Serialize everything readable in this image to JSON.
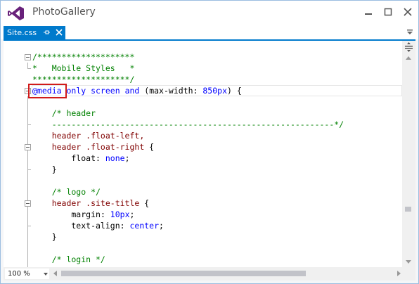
{
  "window": {
    "title": "PhotoGallery",
    "logo_icon": "visual-studio-logo",
    "controls": [
      "minimize-icon",
      "maximize-icon",
      "close-icon"
    ]
  },
  "tabs": [
    {
      "label": "Site.css",
      "active": true,
      "pinned_icon": "pin-icon",
      "close_icon": "close-icon"
    }
  ],
  "colors": {
    "accent": "#007acc",
    "comment": "#008000",
    "keyword": "#0000ff",
    "selector": "#800000",
    "property": "#ff0000",
    "value": "#0000ff",
    "highlight_box": "#d11a1a"
  },
  "editor": {
    "lines": [
      {
        "segments": [
          {
            "t": "/********************",
            "c": "comment"
          }
        ]
      },
      {
        "segments": [
          {
            "t": "*   Mobile Styles   *",
            "c": "comment"
          }
        ]
      },
      {
        "segments": [
          {
            "t": "********************/",
            "c": "comment"
          }
        ]
      },
      {
        "segments": [
          {
            "t": "@media",
            "c": "keyword"
          },
          {
            "t": " only screen ",
            "c": "keyword"
          },
          {
            "t": "and",
            "c": "keyword"
          },
          {
            "t": " (",
            "c": "plain"
          },
          {
            "t": "max-width",
            "c": "property"
          },
          {
            "t": ": ",
            "c": "plain"
          },
          {
            "t": "850px",
            "c": "value"
          },
          {
            "t": ") {",
            "c": "plain"
          }
        ]
      },
      {
        "segments": []
      },
      {
        "segments": [
          {
            "t": "    /* header",
            "c": "comment"
          }
        ]
      },
      {
        "segments": [
          {
            "t": "    ----------------------------------------------------------*/",
            "c": "comment"
          }
        ]
      },
      {
        "segments": [
          {
            "t": "    header .float-left,",
            "c": "selector"
          }
        ]
      },
      {
        "segments": [
          {
            "t": "    header .float-right",
            "c": "selector"
          },
          {
            "t": " {",
            "c": "plain"
          }
        ]
      },
      {
        "segments": [
          {
            "t": "        float",
            "c": "property"
          },
          {
            "t": ": ",
            "c": "plain"
          },
          {
            "t": "none",
            "c": "value"
          },
          {
            "t": ";",
            "c": "plain"
          }
        ]
      },
      {
        "segments": [
          {
            "t": "    }",
            "c": "plain"
          }
        ]
      },
      {
        "segments": []
      },
      {
        "segments": [
          {
            "t": "    /* logo */",
            "c": "comment"
          }
        ]
      },
      {
        "segments": [
          {
            "t": "    header .site-title",
            "c": "selector"
          },
          {
            "t": " {",
            "c": "plain"
          }
        ]
      },
      {
        "segments": [
          {
            "t": "        margin",
            "c": "property"
          },
          {
            "t": ": ",
            "c": "plain"
          },
          {
            "t": "10px",
            "c": "value"
          },
          {
            "t": ";",
            "c": "plain"
          }
        ]
      },
      {
        "segments": [
          {
            "t": "        text-align",
            "c": "property"
          },
          {
            "t": ": ",
            "c": "plain"
          },
          {
            "t": "center",
            "c": "value"
          },
          {
            "t": ";",
            "c": "plain"
          }
        ]
      },
      {
        "segments": [
          {
            "t": "    }",
            "c": "plain"
          }
        ]
      },
      {
        "segments": []
      },
      {
        "segments": [
          {
            "t": "    /* login */",
            "c": "comment"
          }
        ]
      }
    ],
    "fold_lines": [
      0,
      3,
      8,
      13
    ]
  },
  "statusbar": {
    "zoom": "100 %"
  }
}
